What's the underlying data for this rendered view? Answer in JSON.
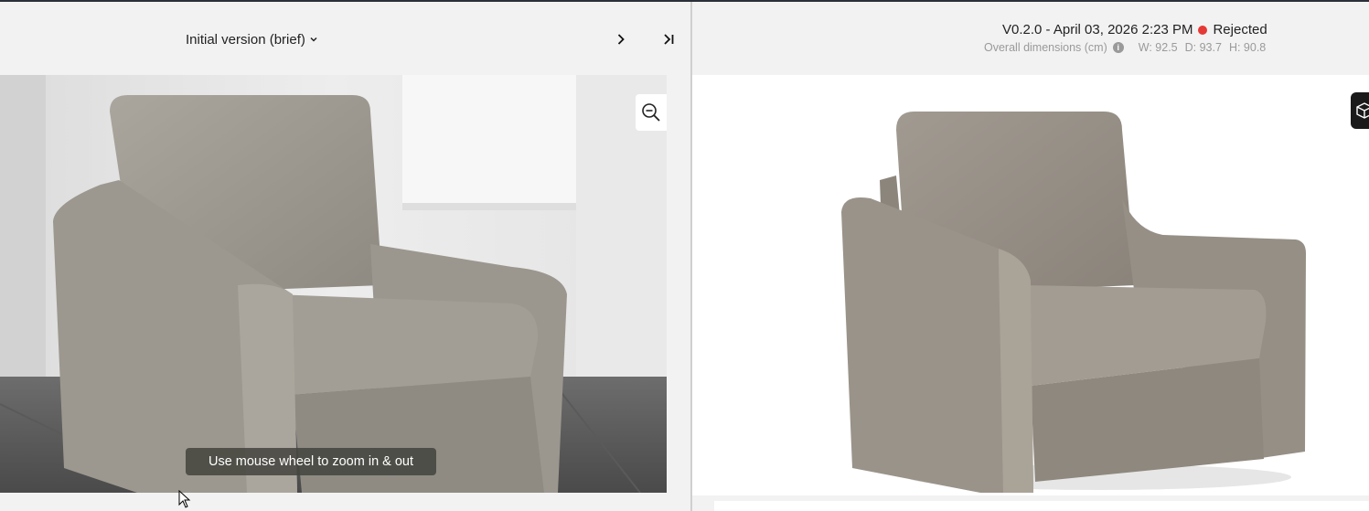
{
  "left": {
    "version_label": "Initial version (brief)",
    "zoom_tooltip": "Use mouse wheel to zoom in & out",
    "icons": {
      "dropdown": "chevron-down-icon",
      "next": "chevron-right-icon",
      "last": "skip-to-end-icon",
      "zoom": "zoom-out-icon"
    }
  },
  "right": {
    "version_line": "V0.2.0 - April 03, 2026 2:23 PM",
    "status": "Rejected",
    "status_color": "#e53935",
    "dimensions_label": "Overall dimensions (cm)",
    "width": "W: 92.5",
    "depth": "D: 93.7",
    "height": "H: 90.8",
    "icons": {
      "info": "info-icon",
      "viewer": "cube-icon"
    }
  }
}
